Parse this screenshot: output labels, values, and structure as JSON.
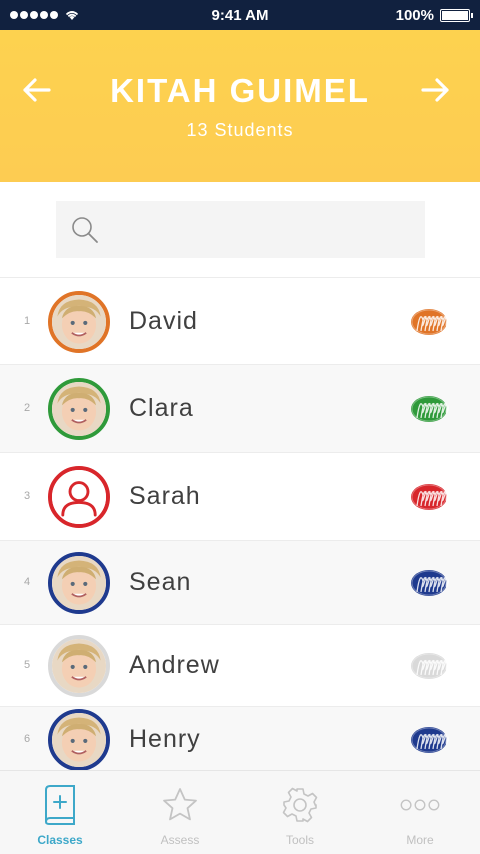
{
  "status_bar": {
    "time": "9:41 AM",
    "battery": "100%"
  },
  "header": {
    "title": "KITAH GUIMEL",
    "subtitle": "13 Students",
    "bg_color": "#fdd24f"
  },
  "search": {
    "placeholder": ""
  },
  "students": [
    {
      "number": "1",
      "name": "David",
      "color": "#e07427",
      "avatar": "photo"
    },
    {
      "number": "2",
      "name": "Clara",
      "color": "#2f9a3a",
      "avatar": "photo"
    },
    {
      "number": "3",
      "name": "Sarah",
      "color": "#d8262b",
      "avatar": "placeholder"
    },
    {
      "number": "4",
      "name": "Sean",
      "color": "#1f3a8e",
      "avatar": "photo"
    },
    {
      "number": "5",
      "name": "Andrew",
      "color": "#d9d9d9",
      "avatar": "photo"
    },
    {
      "number": "6",
      "name": "Henry",
      "color": "#1f3a8e",
      "avatar": "photo"
    }
  ],
  "tabs": [
    {
      "label": "Classes",
      "icon": "book-icon",
      "active": true
    },
    {
      "label": "Assess",
      "icon": "star-icon",
      "active": false
    },
    {
      "label": "Tools",
      "icon": "gear-icon",
      "active": false
    },
    {
      "label": "More",
      "icon": "more-icon",
      "active": false
    }
  ],
  "colors": {
    "accent": "#3da8c9",
    "status_bar": "#11213f"
  }
}
